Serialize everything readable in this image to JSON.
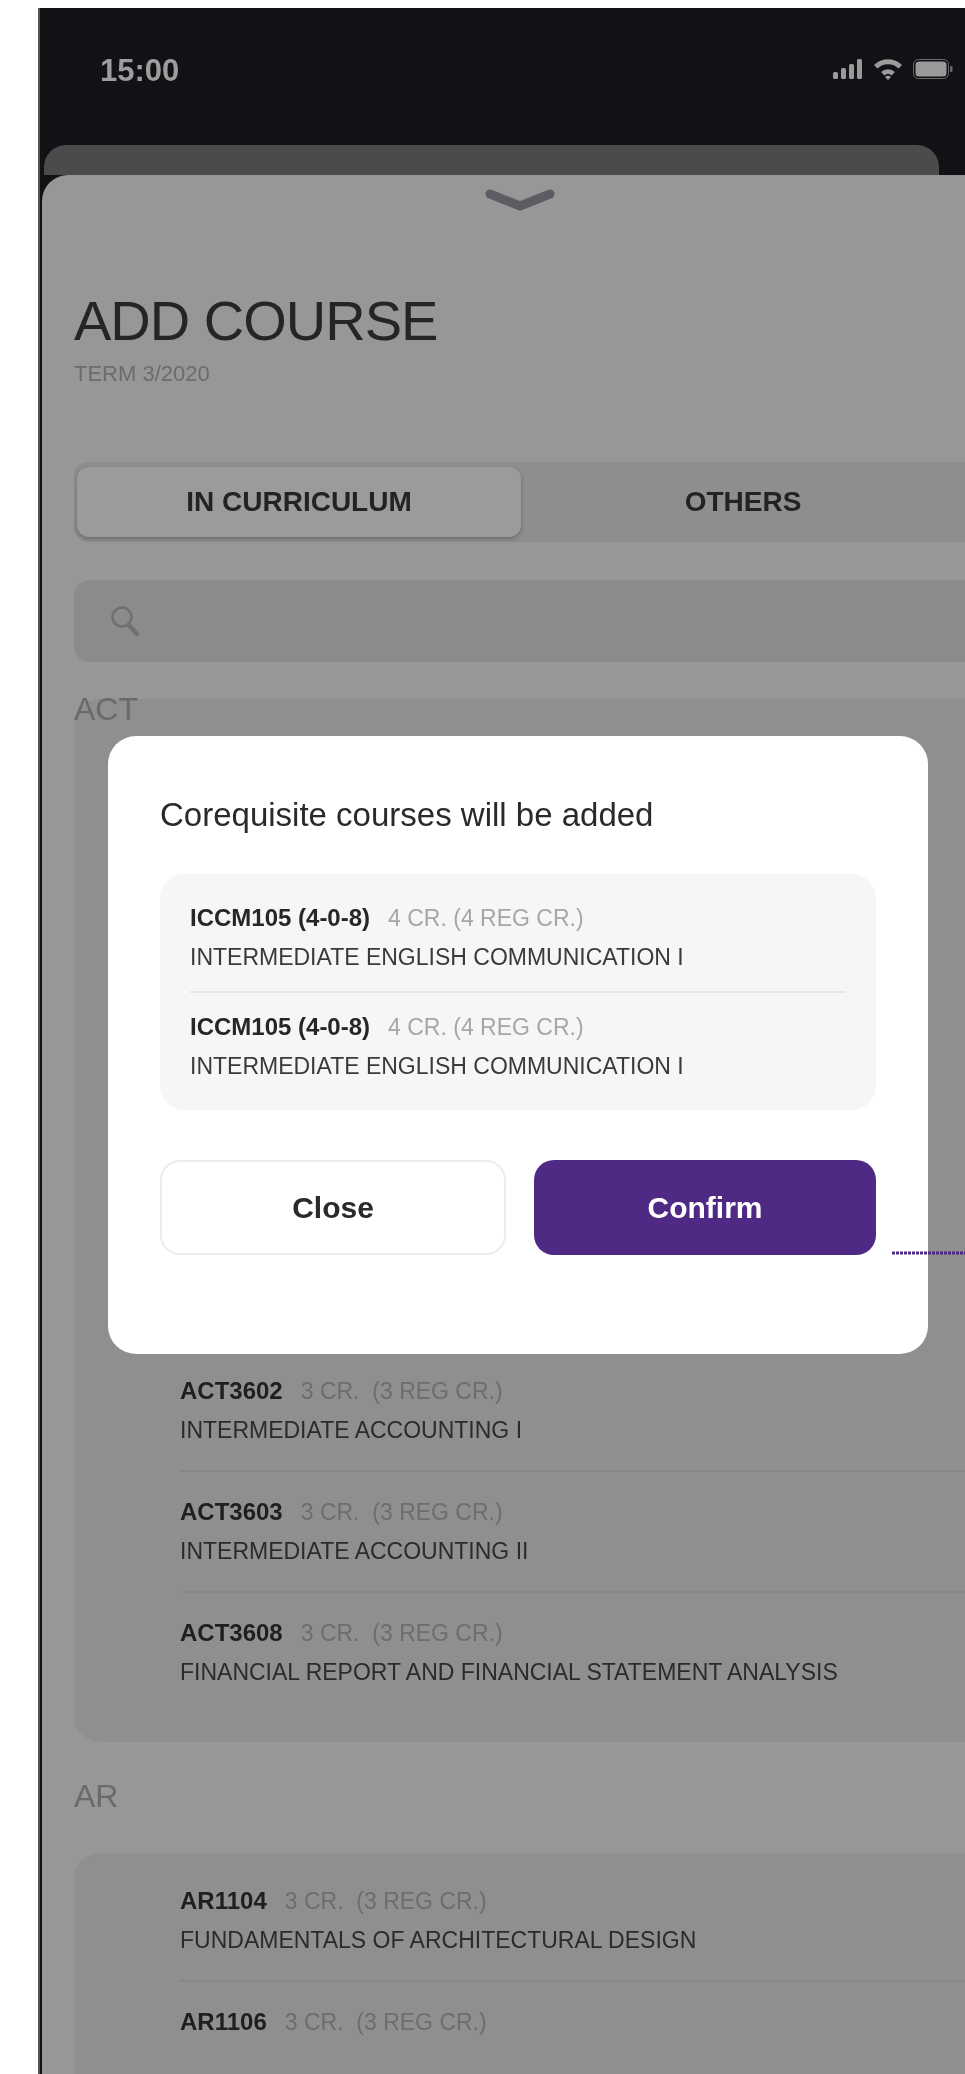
{
  "status_bar": {
    "time": "15:00"
  },
  "sheet": {
    "title": "ADD COURSE",
    "subtitle": "TERM 3/2020",
    "tabs": [
      {
        "label": "IN CURRICULUM",
        "selected": true
      },
      {
        "label": "OTHERS",
        "selected": false
      }
    ],
    "groups": [
      {
        "name": "ACT",
        "courses": [
          {
            "code": "ACT3602",
            "credits": "3 CR.  (3 REG CR.)",
            "name": "INTERMEDIATE ACCOUNTING I"
          },
          {
            "code": "ACT3603",
            "credits": "3 CR.  (3 REG CR.)",
            "name": "INTERMEDIATE ACCOUNTING II"
          },
          {
            "code": "ACT3608",
            "credits": "3 CR.  (3 REG CR.)",
            "name": "FINANCIAL REPORT AND FINANCIAL STATEMENT ANALYSIS"
          }
        ]
      },
      {
        "name": "AR",
        "courses": [
          {
            "code": "AR1104",
            "credits": "3 CR.  (3 REG CR.)",
            "name": "FUNDAMENTALS OF ARCHITECTURAL DESIGN"
          },
          {
            "code": "AR1106",
            "credits": "3 CR.  (3 REG CR.)"
          }
        ]
      }
    ]
  },
  "dialog": {
    "title": "Corequisite courses will be added",
    "courses": [
      {
        "code": "ICCM105 (4-0-8)",
        "credits": "4 CR. (4 REG CR.)",
        "name": "INTERMEDIATE ENGLISH COMMUNICATION I"
      },
      {
        "code": "ICCM105 (4-0-8)",
        "credits": "4 CR. (4 REG CR.)",
        "name": "INTERMEDIATE ENGLISH COMMUNICATION I"
      }
    ],
    "buttons": [
      {
        "label": "Close",
        "kind": "secondary"
      },
      {
        "label": "Confirm",
        "kind": "primary"
      }
    ]
  }
}
